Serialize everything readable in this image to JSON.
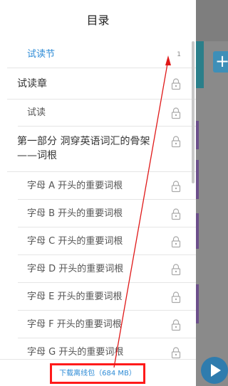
{
  "drawer": {
    "title": "目录",
    "active": {
      "label": "试读节",
      "page": "1"
    },
    "chapter": "试读章",
    "section": "试读",
    "part": "第一部分 洞穿英语词汇的骨架——词根",
    "subs": [
      "字母 A 开头的重要词根",
      "字母 B 开头的重要词根",
      "字母 C 开头的重要词根",
      "字母 D 开头的重要词根",
      "字母 E 开头的重要词根",
      "字母 F 开头的重要词根",
      "字母 G 开头的重要词根"
    ],
    "download_label": "下载离线包（684 MB）"
  },
  "background": {
    "plus_label": "+"
  },
  "colors": {
    "accent": "#2d8bd6",
    "highlight": "#ff1a1a"
  },
  "icons": {
    "lock": "lock-icon",
    "play": "play-icon"
  }
}
